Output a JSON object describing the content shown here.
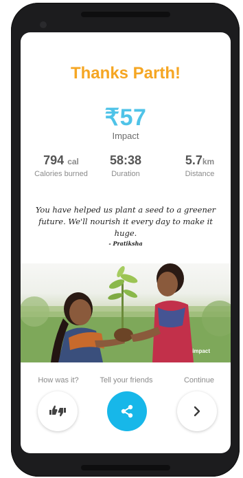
{
  "header": {
    "title": "Thanks Parth!"
  },
  "impact": {
    "amount": "₹57",
    "label": "Impact"
  },
  "stats": {
    "calories_value": "794",
    "calories_unit": "cal",
    "calories_label": "Calories burned",
    "duration_value": "58:38",
    "duration_label": "Duration",
    "distance_value": "5.7",
    "distance_unit": "km",
    "distance_label": "Distance"
  },
  "quote": {
    "text": "You have helped us plant a seed to a greener future. We'll nourish it every day to make it huge.",
    "signature": "- Pratiksha"
  },
  "photo": {
    "brand": "impact"
  },
  "actions": {
    "rate_label": "How was it?",
    "share_label": "Tell your friends",
    "continue_label": "Continue"
  },
  "icons": {
    "rate": "thumbs-up-down-icon",
    "share": "share-icon",
    "next": "chevron-right-icon"
  },
  "colors": {
    "title": "#f5a623",
    "impact": "#4fc3e8",
    "share_button": "#17b7e9"
  }
}
